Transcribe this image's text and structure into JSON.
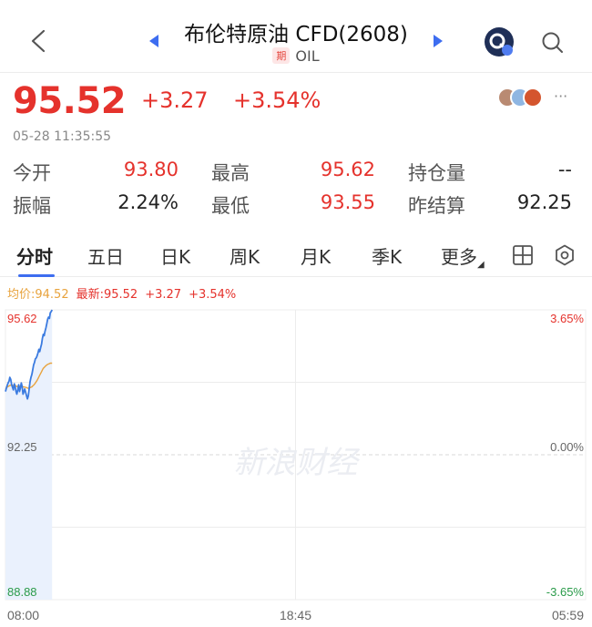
{
  "header": {
    "title": "布伦特原油 CFD(2608)",
    "badge": "期",
    "code": "OIL"
  },
  "quote": {
    "price": "95.52",
    "change": "+3.27",
    "change_pct": "+3.54%",
    "time": "05-28 11:35:55"
  },
  "stats": [
    {
      "label": "今开",
      "value": "93.80",
      "color": "#e5322c"
    },
    {
      "label": "最高",
      "value": "95.62",
      "color": "#e5322c"
    },
    {
      "label": "持仓量",
      "value": "--",
      "color": "#222222"
    },
    {
      "label": "振幅",
      "value": "2.24%",
      "color": "#222222"
    },
    {
      "label": "最低",
      "value": "93.55",
      "color": "#e5322c"
    },
    {
      "label": "昨结算",
      "value": "92.25",
      "color": "#222222"
    }
  ],
  "tabs": [
    "分时",
    "五日",
    "日K",
    "周K",
    "月K",
    "季K",
    "更多"
  ],
  "info": {
    "avg": "均价:94.52",
    "latest": "最新:95.52",
    "change": "+3.27",
    "pct": "+3.54%"
  },
  "chart_data": {
    "type": "line",
    "x_ticks": [
      "08:00",
      "18:45",
      "05:59"
    ],
    "y_ticks_left": [
      "95.62",
      "92.25",
      "88.88"
    ],
    "y_ticks_right": [
      "3.65%",
      "0.00%",
      "-3.65%"
    ],
    "ylim": [
      88.88,
      95.62
    ],
    "reference": 92.25,
    "watermark": "新浪财经",
    "colors": {
      "price": "#3b7be0",
      "avg": "#e8a33d",
      "up": "#e5322c",
      "down": "#2a9b4a"
    },
    "x_index": [
      0,
      2,
      4,
      6,
      8,
      10,
      12,
      14,
      16,
      18,
      20,
      22,
      24,
      26,
      28,
      30,
      32,
      34,
      36,
      38,
      40,
      42,
      44,
      46,
      48,
      50,
      52,
      54,
      56,
      58,
      60,
      62,
      64,
      66,
      68,
      70,
      72,
      74,
      76,
      78,
      80,
      82,
      84,
      86,
      88,
      90,
      92,
      94,
      96,
      98,
      100,
      102,
      104,
      106
    ],
    "price": [
      93.72,
      93.8,
      93.86,
      93.92,
      93.96,
      94.05,
      94.0,
      93.88,
      93.82,
      93.76,
      93.9,
      93.84,
      93.72,
      93.66,
      93.76,
      93.88,
      93.72,
      93.8,
      93.92,
      93.84,
      93.66,
      93.72,
      93.78,
      93.7,
      93.62,
      93.55,
      93.62,
      93.8,
      93.95,
      94.05,
      94.12,
      94.22,
      94.34,
      94.4,
      94.48,
      94.5,
      94.55,
      94.62,
      94.7,
      94.65,
      94.74,
      94.82,
      94.95,
      95.05,
      95.02,
      95.12,
      95.2,
      95.3,
      95.4,
      95.45,
      95.42,
      95.55,
      95.58,
      95.62
    ],
    "avg": [
      93.78,
      93.8,
      93.82,
      93.84,
      93.85,
      93.86,
      93.87,
      93.87,
      93.86,
      93.86,
      93.86,
      93.86,
      93.85,
      93.84,
      93.84,
      93.84,
      93.84,
      93.84,
      93.84,
      93.84,
      93.83,
      93.83,
      93.82,
      93.82,
      93.81,
      93.8,
      93.8,
      93.8,
      93.81,
      93.82,
      93.83,
      93.85,
      93.87,
      93.89,
      93.92,
      93.95,
      93.98,
      94.02,
      94.06,
      94.1,
      94.14,
      94.18,
      94.22,
      94.26,
      94.28,
      94.3,
      94.32,
      94.34,
      94.35,
      94.36,
      94.37,
      94.38,
      94.38,
      94.38
    ]
  }
}
